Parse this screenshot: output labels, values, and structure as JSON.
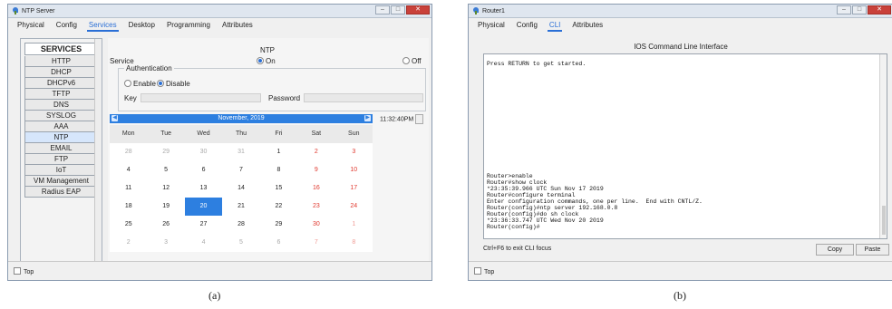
{
  "panel_a": {
    "window_title": "NTP Server",
    "tabs": [
      "Physical",
      "Config",
      "Services",
      "Desktop",
      "Programming",
      "Attributes"
    ],
    "active_tab": "Services",
    "services_header": "SERVICES",
    "services": [
      "HTTP",
      "DHCP",
      "DHCPv6",
      "TFTP",
      "DNS",
      "SYSLOG",
      "AAA",
      "NTP",
      "EMAIL",
      "FTP",
      "IoT",
      "VM Management",
      "Radius EAP"
    ],
    "active_service": "NTP",
    "pane_title": "NTP",
    "service_label": "Service",
    "on_label": "On",
    "off_label": "Off",
    "auth_label": "Authentication",
    "enable_label": "Enable",
    "disable_label": "Disable",
    "key_label": "Key",
    "password_label": "Password",
    "month_year": "November,  2019",
    "time": "11:32:40PM",
    "weekdays": [
      "Mon",
      "Tue",
      "Wed",
      "Thu",
      "Fri",
      "Sat",
      "Sun"
    ],
    "weeks": [
      [
        "28",
        "29",
        "30",
        "31",
        "1",
        "2",
        "3"
      ],
      [
        "4",
        "5",
        "6",
        "7",
        "8",
        "9",
        "10"
      ],
      [
        "11",
        "12",
        "13",
        "14",
        "15",
        "16",
        "17"
      ],
      [
        "18",
        "19",
        "20",
        "21",
        "22",
        "23",
        "24"
      ],
      [
        "25",
        "26",
        "27",
        "28",
        "29",
        "30",
        "1"
      ],
      [
        "2",
        "3",
        "4",
        "5",
        "6",
        "7",
        "8"
      ]
    ],
    "selected_day": "20",
    "top_label": "Top",
    "caption": "(a)"
  },
  "panel_b": {
    "window_title": "Router1",
    "tabs": [
      "Physical",
      "Config",
      "CLI",
      "Attributes"
    ],
    "active_tab": "CLI",
    "cli_title": "IOS Command Line Interface",
    "cli_top": "Press RETURN to get started.",
    "cli_lines": [
      "Router>enable",
      "Router#show clock",
      "*23:35:39.966 UTC Sun Nov 17 2019",
      "Router#configure terminal",
      "Enter configuration commands, one per line.  End with CNTL/Z.",
      "Router(config)#ntp server 192.168.0.8",
      "Router(config)#do sh clock",
      "*23:36:33.747 UTC Wed Nov 20 2019",
      "Router(config)#"
    ],
    "focus_hint": "Ctrl+F6 to exit CLI focus",
    "copy_label": "Copy",
    "paste_label": "Paste",
    "top_label": "Top",
    "caption": "(b)"
  },
  "colors": {
    "accent": "#2d7fe0",
    "weekend": "#e0392f",
    "close": "#c9413a"
  },
  "icons": {
    "window": "packet-tracer-icon"
  }
}
